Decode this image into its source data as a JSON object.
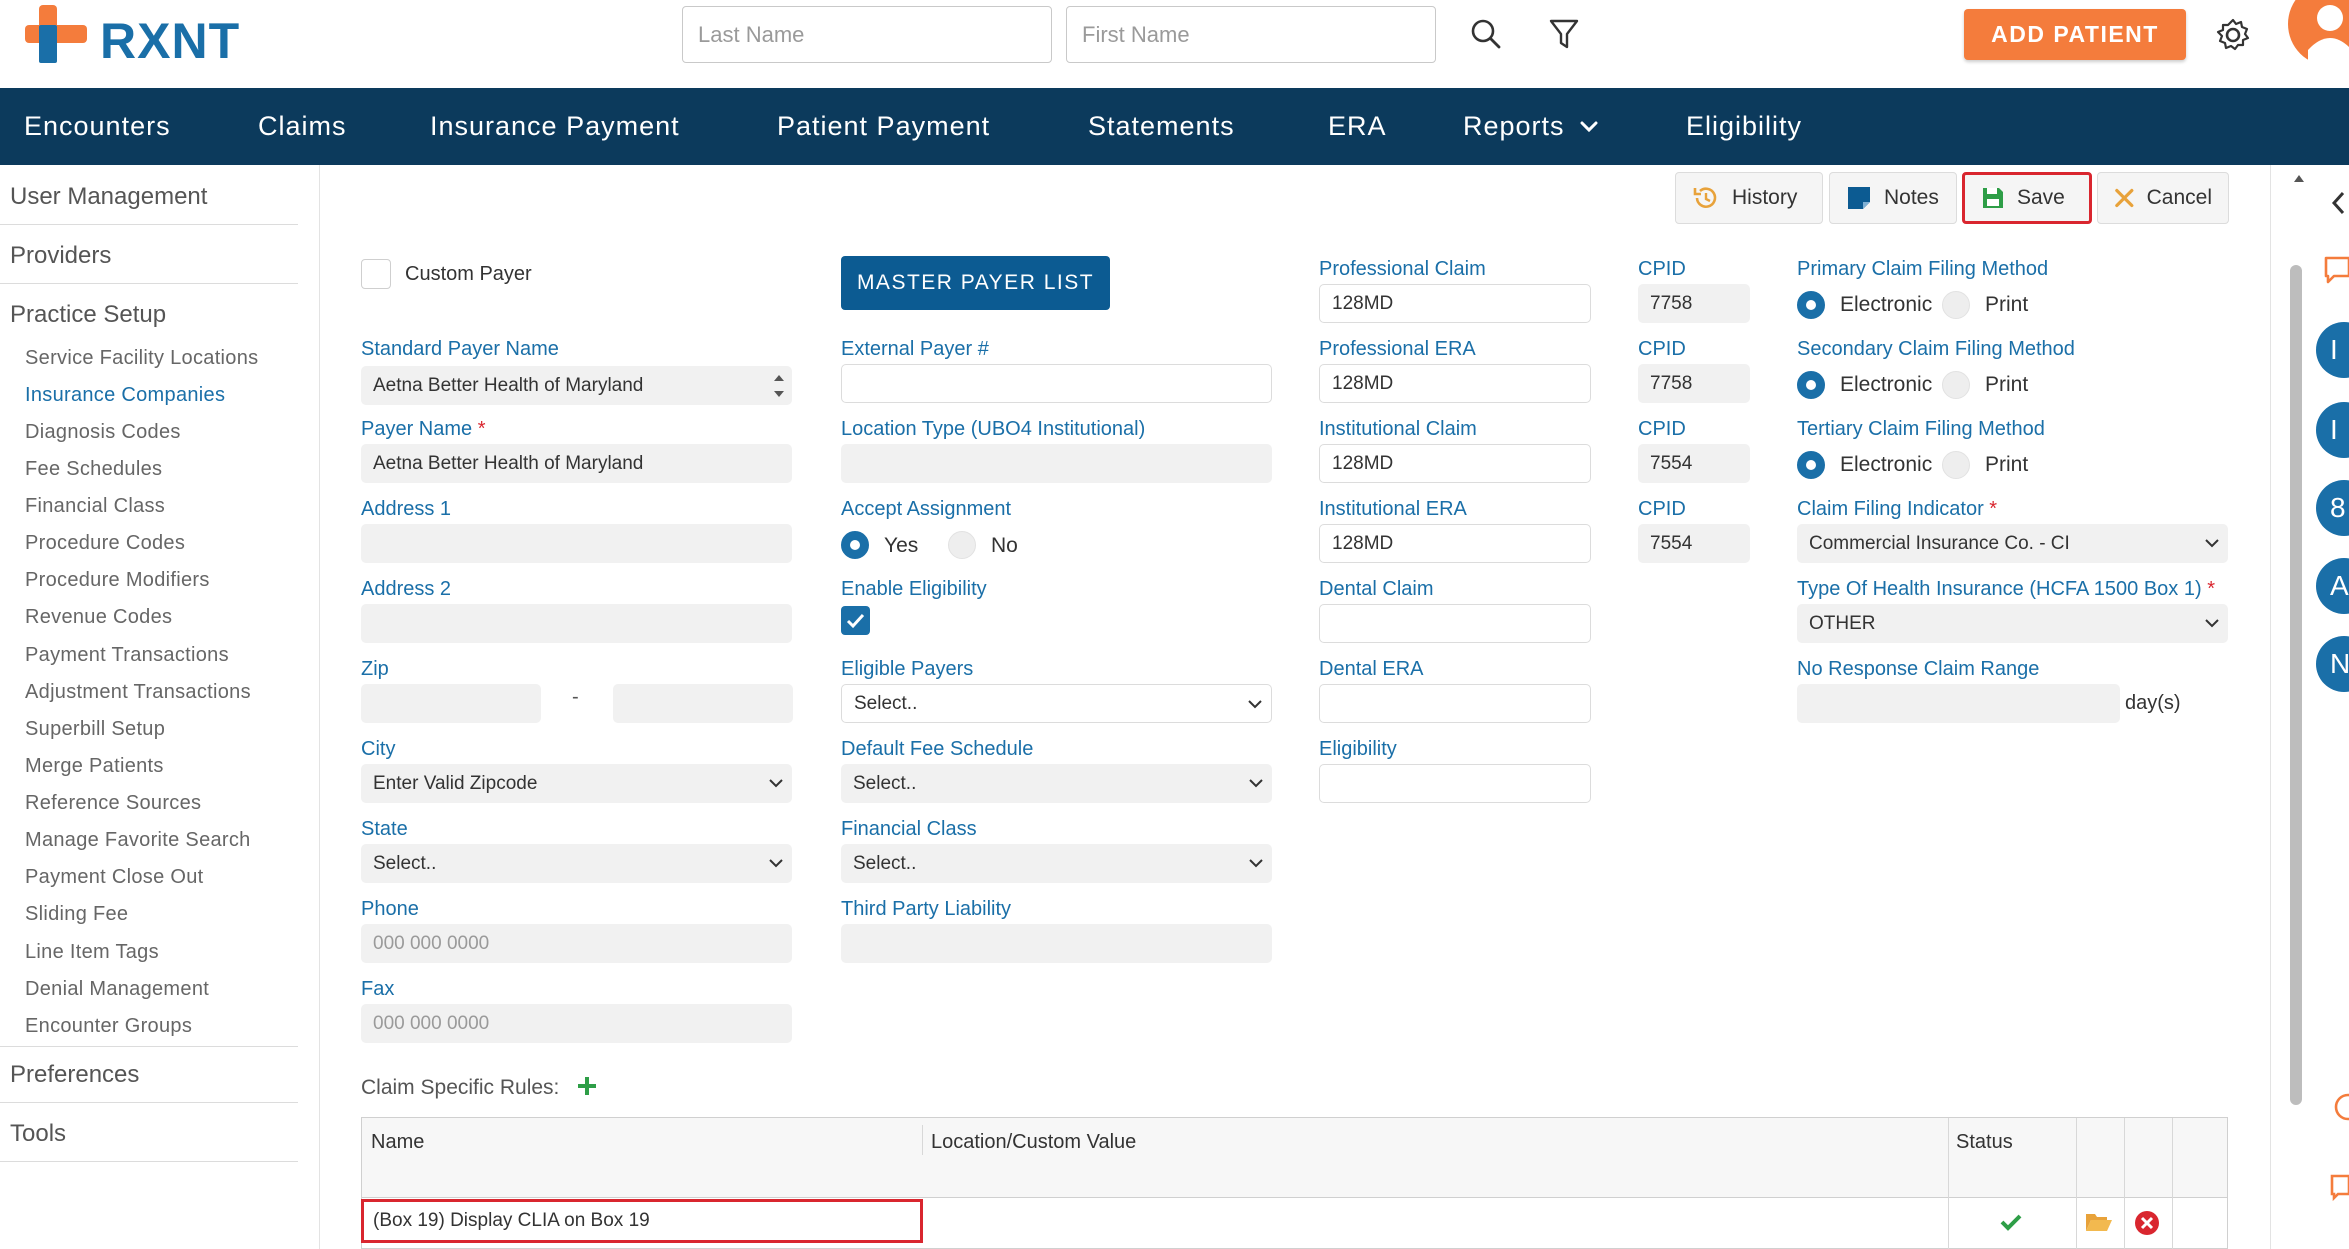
{
  "header": {
    "logo_text": "RXNT",
    "last_name_placeholder": "Last Name",
    "first_name_placeholder": "First Name",
    "add_patient_label": "ADD PATIENT",
    "brand_orange": "#f47c3c",
    "brand_blue": "#1a6fa8"
  },
  "nav": {
    "items": [
      "Encounters",
      "Claims",
      "Insurance Payment",
      "Patient Payment",
      "Statements",
      "ERA",
      "Reports",
      "Eligibility"
    ],
    "bg_color": "#0c3a5c"
  },
  "sidebar": {
    "groups": [
      "User Management",
      "Providers",
      "Practice Setup",
      "Preferences",
      "Tools"
    ],
    "practice_setup_items": [
      "Service Facility Locations",
      "Insurance Companies",
      "Diagnosis Codes",
      "Fee Schedules",
      "Financial Class",
      "Procedure Codes",
      "Procedure Modifiers",
      "Revenue Codes",
      "Payment Transactions",
      "Adjustment Transactions",
      "Superbill Setup",
      "Merge Patients",
      "Reference Sources",
      "Manage Favorite Search",
      "Payment Close Out",
      "Sliding Fee",
      "Line Item Tags",
      "Denial Management",
      "Encounter Groups"
    ],
    "active_item": "Insurance Companies"
  },
  "toolbar": {
    "history": "History",
    "notes": "Notes",
    "save": "Save",
    "cancel": "Cancel"
  },
  "form": {
    "custom_payer_label": "Custom Payer",
    "custom_payer_checked": false,
    "master_payer_list": "MASTER PAYER LIST",
    "standard_payer_name": {
      "label": "Standard Payer Name",
      "value": "Aetna Better Health of Maryland"
    },
    "payer_name": {
      "label": "Payer Name",
      "value": "Aetna Better Health of Maryland"
    },
    "address1": {
      "label": "Address 1",
      "value": ""
    },
    "address2": {
      "label": "Address 2",
      "value": ""
    },
    "zip": {
      "label": "Zip",
      "value1": "",
      "value2": "",
      "separator": "-"
    },
    "city": {
      "label": "City",
      "value": "Enter Valid Zipcode"
    },
    "state": {
      "label": "State",
      "value": "Select.."
    },
    "phone": {
      "label": "Phone",
      "placeholder": "000 000 0000"
    },
    "fax": {
      "label": "Fax",
      "placeholder": "000 000 0000"
    },
    "external_payer": {
      "label": "External Payer #",
      "value": ""
    },
    "location_type": {
      "label": "Location Type (UBO4 Institutional)",
      "value": ""
    },
    "accept_assignment": {
      "label": "Accept Assignment",
      "yes": "Yes",
      "no": "No",
      "selected": "Yes"
    },
    "enable_eligibility": {
      "label": "Enable Eligibility",
      "checked": true
    },
    "eligible_payers": {
      "label": "Eligible Payers",
      "value": "Select.."
    },
    "default_fee_schedule": {
      "label": "Default Fee Schedule",
      "value": "Select.."
    },
    "financial_class": {
      "label": "Financial Class",
      "value": "Select.."
    },
    "third_party_liability": {
      "label": "Third Party Liability",
      "value": ""
    },
    "professional_claim": {
      "label": "Professional Claim",
      "value": "128MD",
      "cpid_label": "CPID",
      "cpid": "7758"
    },
    "professional_era": {
      "label": "Professional ERA",
      "value": "128MD",
      "cpid_label": "CPID",
      "cpid": "7758"
    },
    "institutional_claim": {
      "label": "Institutional Claim",
      "value": "128MD",
      "cpid_label": "CPID",
      "cpid": "7554"
    },
    "institutional_era": {
      "label": "Institutional ERA",
      "value": "128MD",
      "cpid_label": "CPID",
      "cpid": "7554"
    },
    "dental_claim": {
      "label": "Dental Claim",
      "value": ""
    },
    "dental_era": {
      "label": "Dental ERA",
      "value": ""
    },
    "eligibility": {
      "label": "Eligibility",
      "value": ""
    },
    "primary_filing": {
      "label": "Primary Claim Filing Method",
      "opt1": "Electronic",
      "opt2": "Print",
      "selected": "Electronic"
    },
    "secondary_filing": {
      "label": "Secondary Claim Filing Method",
      "opt1": "Electronic",
      "opt2": "Print",
      "selected": "Electronic"
    },
    "tertiary_filing": {
      "label": "Tertiary Claim Filing Method",
      "opt1": "Electronic",
      "opt2": "Print",
      "selected": "Electronic"
    },
    "claim_filing_indicator": {
      "label": "Claim Filing Indicator",
      "value": "Commercial Insurance Co. - CI"
    },
    "type_of_health_insurance": {
      "label": "Type Of Health Insurance (HCFA 1500 Box 1)",
      "value": "OTHER"
    },
    "no_response_claim_range": {
      "label": "No Response Claim Range",
      "value": "",
      "unit": "day(s)"
    }
  },
  "claim_rules": {
    "label": "Claim Specific Rules:",
    "columns": [
      "Name",
      "Location/Custom Value",
      "Status"
    ],
    "rows": [
      {
        "name": "(Box 19) Display CLIA on Box 19",
        "value": "",
        "status": "active"
      }
    ]
  },
  "right_rail": {
    "circles": [
      "I",
      "I",
      "8",
      "A",
      "N"
    ]
  }
}
